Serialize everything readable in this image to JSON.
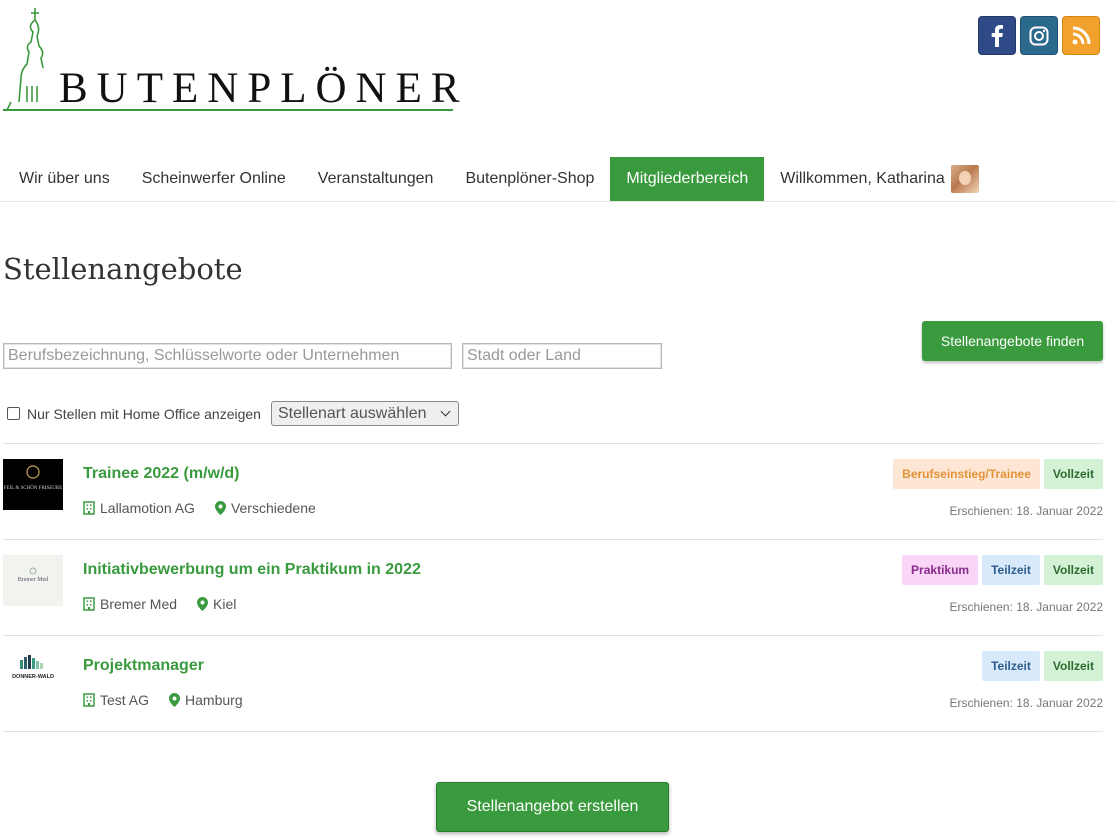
{
  "brand": {
    "name": "BUTENPLÖNER"
  },
  "social": [
    {
      "name": "facebook",
      "icon": "facebook-icon",
      "color": "#2f4a86"
    },
    {
      "name": "instagram",
      "icon": "instagram-icon",
      "color": "#2c6a8d"
    },
    {
      "name": "rss",
      "icon": "rss-icon",
      "color": "#f1a12e"
    }
  ],
  "nav": {
    "items": [
      "Wir über uns",
      "Scheinwerfer Online",
      "Veranstaltungen",
      "Butenplöner-Shop",
      "Mitgliederbereich"
    ],
    "active": "Mitgliederbereich",
    "welcome": "Willkommen, Katharina"
  },
  "page": {
    "title": "Stellenangebote"
  },
  "search": {
    "keyword_placeholder": "Berufsbezeichnung, Schlüsselworte oder Unternehmen",
    "keyword_value": "",
    "city_placeholder": "Stadt oder Land",
    "city_value": "",
    "find_label": "Stellenangebote finden",
    "home_office_label": "Nur Stellen mit Home Office anzeigen",
    "home_office_checked": false,
    "type_select_value": "Stellenart auswählen"
  },
  "jobs": [
    {
      "title": "Trainee 2022 (m/w/d)",
      "company": "Lallamotion AG",
      "location": "Verschiedene",
      "tags": [
        "Berufseinstieg/Trainee",
        "Vollzeit"
      ],
      "date": "Erschienen: 18. Januar 2022",
      "logo_text": "FEIL & SCHÖN FRISEURE"
    },
    {
      "title": "Initiativbewerbung um ein Praktikum in 2022",
      "company": "Bremer Med",
      "location": "Kiel",
      "tags": [
        "Praktikum",
        "Teilzeit",
        "Vollzeit"
      ],
      "date": "Erschienen: 18. Januar 2022",
      "logo_text": "Bremer Med"
    },
    {
      "title": "Projektmanager",
      "company": "Test AG",
      "location": "Hamburg",
      "tags": [
        "Teilzeit",
        "Vollzeit"
      ],
      "date": "Erschienen: 18. Januar 2022",
      "logo_text": "DONNER-WALD"
    }
  ],
  "create_label": "Stellenangebot erstellen",
  "colors": {
    "accent": "#3a9a3e",
    "accent_dark": "#2a7d2e"
  }
}
